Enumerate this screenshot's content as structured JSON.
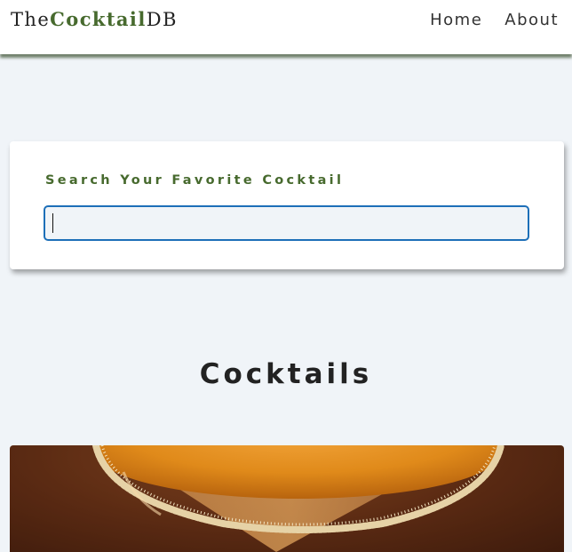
{
  "navbar": {
    "logo": {
      "part1": "The",
      "part2": "Cocktail",
      "part3": "DB"
    },
    "links": [
      {
        "label": "Home"
      },
      {
        "label": "About"
      }
    ]
  },
  "search": {
    "label": "Search Your Favorite Cocktail",
    "value": ""
  },
  "cocktails": {
    "title": "Cocktails"
  },
  "colors": {
    "brand_green": "#476a2e",
    "page_background": "#f0f4f8",
    "input_focus_border": "#1d6fb8",
    "drink_orange": "#e8921c"
  }
}
